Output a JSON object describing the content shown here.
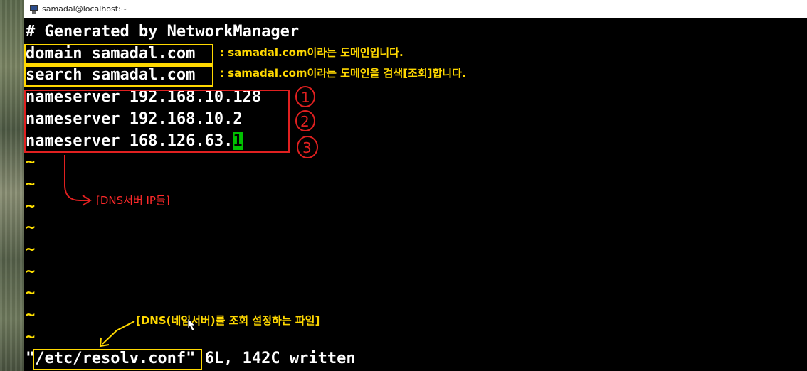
{
  "window": {
    "title": "samadal@localhost:~"
  },
  "editor": {
    "header": "# Generated by NetworkManager",
    "domain_line": "domain samadal.com",
    "search_line": "search samadal.com",
    "nameservers": [
      "nameserver 192.168.10.128",
      "nameserver 192.168.10.2",
      "nameserver 168.126.63."
    ],
    "cursor_char": "1",
    "tilde": "~",
    "status_quote_open": "\"",
    "status_filename": "/etc/resolv.conf",
    "status_rest": "\" 6L, 142C written"
  },
  "annotations": {
    "domain_note": ": samadal.com이라는 도메인입니다.",
    "search_note": ": samadal.com이라는 도메인을 검색[조회]합니다.",
    "dns_ips_note": "[DNS서버 IP들]",
    "file_note": "[DNS(네임서버)를 조회 설정하는 파일]",
    "circled_numbers": [
      "1",
      "2",
      "3"
    ]
  },
  "colors": {
    "terminal_bg": "#000000",
    "text": "#ffffff",
    "tilde": "#ffe000",
    "cursor": "#00c000",
    "annotation_yellow": "#ffd800",
    "annotation_red": "#e02020"
  }
}
